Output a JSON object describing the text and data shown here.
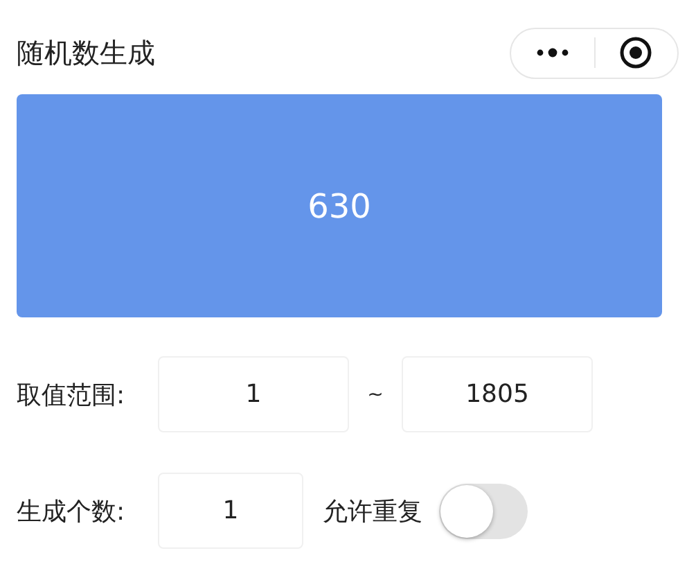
{
  "window": {
    "title": "随机数生成"
  },
  "result": "630",
  "range": {
    "label": "取值范围:",
    "min": "1",
    "separator": "~",
    "max": "1805"
  },
  "count": {
    "label": "生成个数:",
    "value": "1"
  },
  "allow_repeat": {
    "label": "允许重复",
    "on": false
  }
}
